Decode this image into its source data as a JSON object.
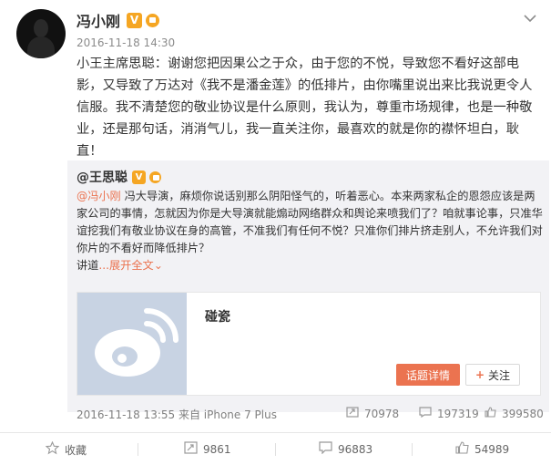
{
  "post": {
    "author": "冯小刚",
    "vip_badge": "V",
    "time": "2016-11-18 14:30",
    "text": "小王主席思聪：谢谢您把因果公之于众，由于您的不悦，导致您不看好这部电影，又导致了万达对《我不是潘金莲》的低排片，由你嘴里说出来比我说更令人信服。我不清楚您的敬业协议是什么原则，我认为，尊重市场规律，也是一种敬业，还是那句话，消消气儿，我一直关注你，最喜欢的就是你的襟怀坦白，耿直！"
  },
  "repost": {
    "author": "@王思聪",
    "vip_badge": "V",
    "mention": "@冯小刚",
    "text": " 冯大导演，麻烦你说话别那么阴阳怪气的，听着恶心。本来两家私企的恩怨应该是两家公司的事情，怎就因为你是大导演就能煽动网络群众和舆论来喷我们了？咱就事论事，只准华谊挖我们有敬业协议在身的高管，不准我们有任何不悦？只准你们排片挤走别人，不允许我们对你片的不看好而降低排片？",
    "truncated_prefix": "讲道",
    "expand_label": "...展开全文",
    "expand_chevron": "⌄",
    "link_card": {
      "title": "碰瓷",
      "topic_button": "话题详情",
      "follow_plus": "+",
      "follow_button": "关注"
    },
    "time_source": "2016-11-18 13:55 来自 iPhone 7 Plus",
    "reposts": "70978",
    "comments": "197319",
    "likes": "399580"
  },
  "actions": {
    "collect": "收藏",
    "repost": "9861",
    "comment": "96883",
    "like": "54989"
  },
  "icons": {
    "more": "chevron-down-icon",
    "collect": "star-icon",
    "repost": "repost-icon",
    "comment": "comment-icon",
    "like": "thumb-up-icon",
    "weibo": "weibo-logo"
  },
  "colors": {
    "accent": "#eb7350",
    "badge": "#f5a623",
    "repost_bg": "#f2f2f5",
    "muted": "#8c8c8c"
  }
}
